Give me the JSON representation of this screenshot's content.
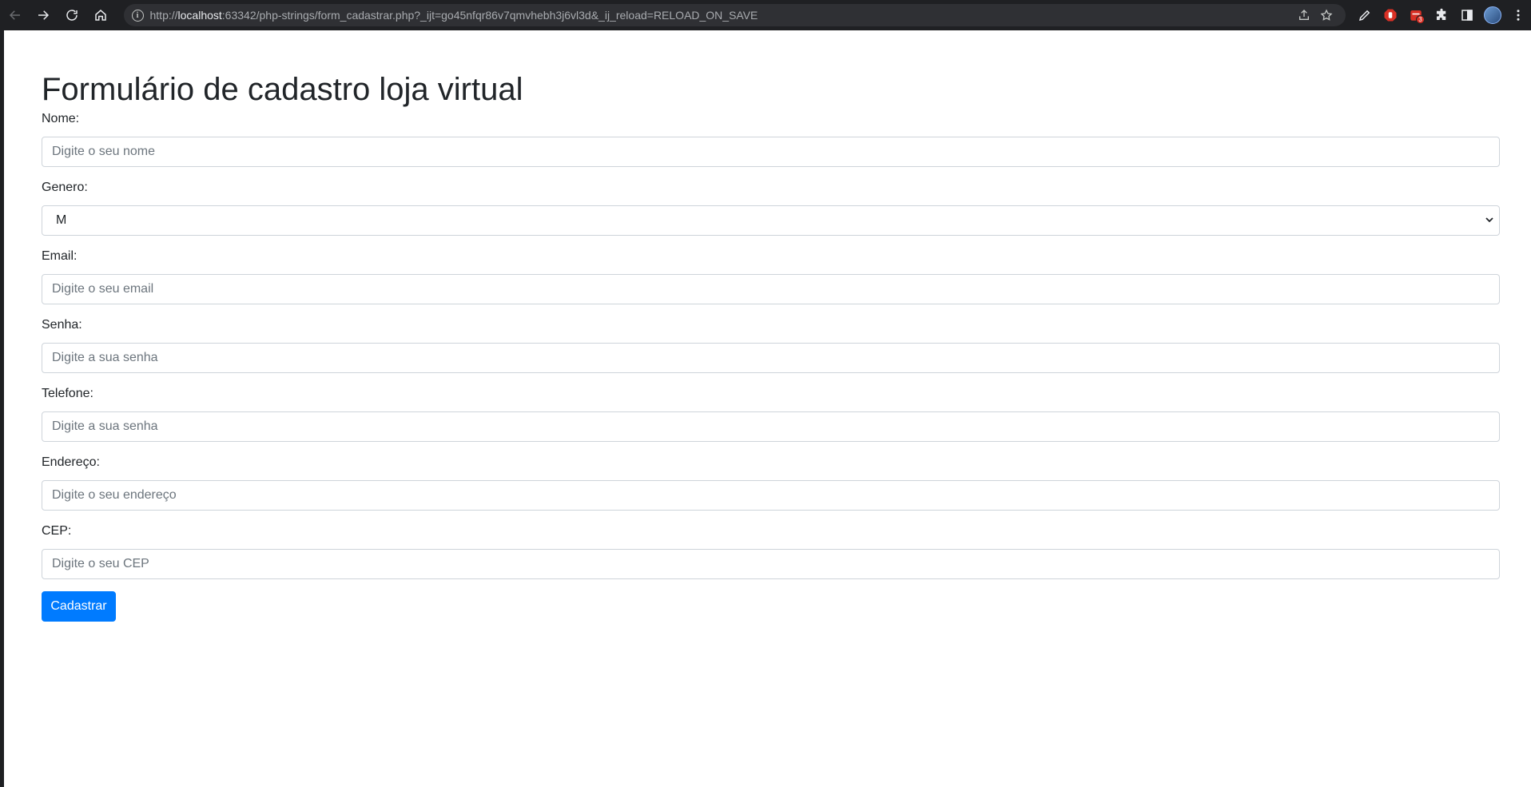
{
  "browser": {
    "url_prefix": "http://",
    "url_host": "localhost",
    "url_rest": ":63342/php-strings/form_cadastrar.php?_ijt=go45nfqr86v7qmvhebh3j6vl3d&_ij_reload=RELOAD_ON_SAVE",
    "extension_badge": "3"
  },
  "form": {
    "title": "Formulário de cadastro loja virtual",
    "fields": [
      {
        "label": "Nome:",
        "placeholder": "Digite o seu nome"
      },
      {
        "label": "Genero:",
        "selected": "M"
      },
      {
        "label": "Email:",
        "placeholder": "Digite o seu email"
      },
      {
        "label": "Senha:",
        "placeholder": "Digite a sua senha"
      },
      {
        "label": "Telefone:",
        "placeholder": "Digite a sua senha"
      },
      {
        "label": "Endereço:",
        "placeholder": "Digite o seu endereço"
      },
      {
        "label": "CEP:",
        "placeholder": "Digite o seu CEP"
      }
    ],
    "submit_label": "Cadastrar"
  },
  "colors": {
    "primary": "#007bff",
    "chrome_bg": "#1f2023"
  }
}
